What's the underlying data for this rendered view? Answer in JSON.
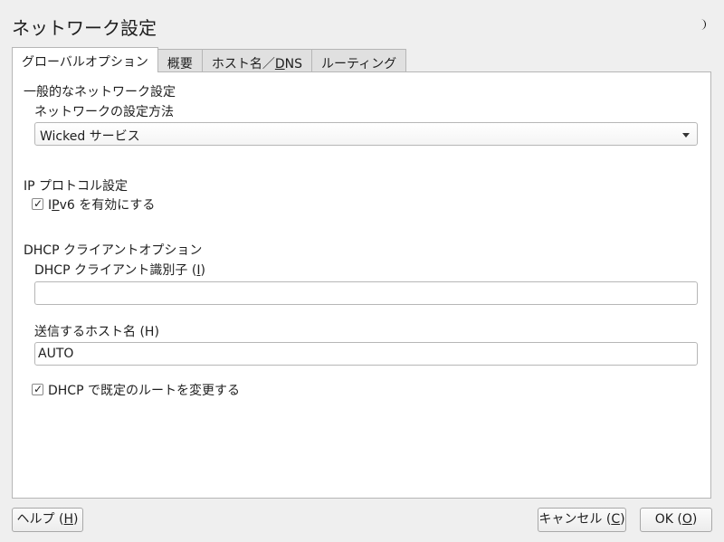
{
  "window": {
    "title": "ネットワーク設定",
    "moon_icon": "moon-icon"
  },
  "tabs": [
    {
      "label": "グローバルオプション",
      "active": true
    },
    {
      "label": "概要",
      "active": false
    },
    {
      "label_pre": "ホスト名／",
      "label_u": "D",
      "label_post": "NS",
      "active": false
    },
    {
      "label": "ルーティング",
      "active": false
    }
  ],
  "general": {
    "heading": "一般的なネットワーク設定",
    "method_label": "ネットワークの設定方法",
    "method_value": "Wicked サービス"
  },
  "ip": {
    "heading": "IP プロトコル設定",
    "ipv6_label_pre": "I",
    "ipv6_label_u": "P",
    "ipv6_label_post": "v6 を有効にする",
    "ipv6_checked": true
  },
  "dhcp": {
    "heading": "DHCP クライアントオプション",
    "client_id_label_pre": "DHCP クライアント識別子 (",
    "client_id_label_u": "I",
    "client_id_label_post": ")",
    "client_id_value": "",
    "hostname_label": "送信するホスト名 (H)",
    "hostname_value": "AUTO",
    "default_route_label": "DHCP で既定のルートを変更する",
    "default_route_checked": true
  },
  "buttons": {
    "help_pre": "ヘルプ (",
    "help_u": "H",
    "help_post": ")",
    "cancel_pre": "キャンセル (",
    "cancel_u": "C",
    "cancel_post": ")",
    "ok_pre": "OK (",
    "ok_u": "O",
    "ok_post": ")"
  }
}
